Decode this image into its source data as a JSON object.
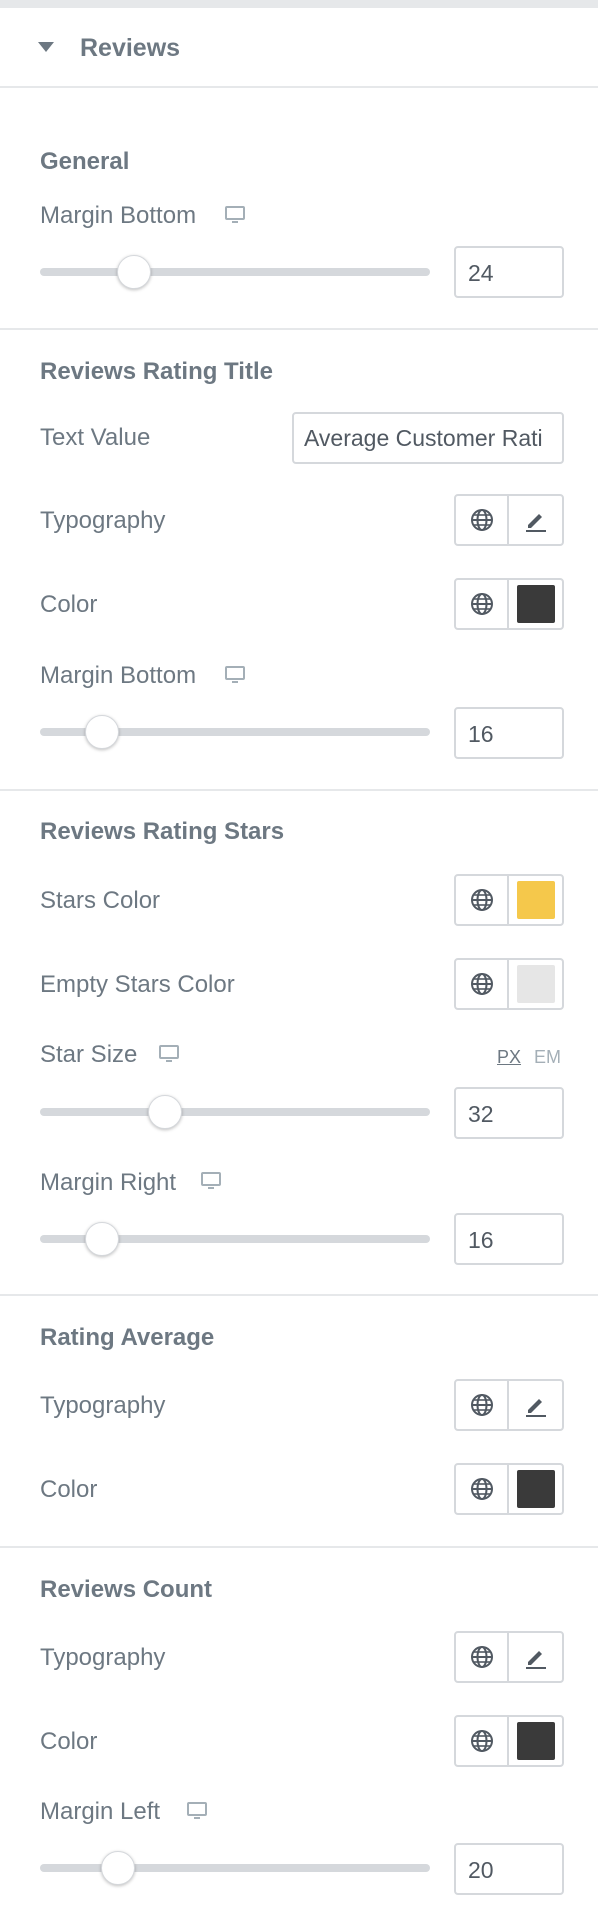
{
  "panel": {
    "title": "Reviews",
    "colors": {
      "dark_swatch": "#3a3a3a",
      "star_color": "#f5c84b",
      "empty_star_color": "#e6e6e6"
    },
    "icons": [
      "caret-down-icon",
      "monitor-icon",
      "globe-icon",
      "pencil-icon"
    ]
  },
  "general": {
    "heading": "General",
    "margin_bottom": {
      "label": "Margin Bottom",
      "value": "24",
      "level": 0.24
    }
  },
  "rating_title": {
    "heading": "Reviews Rating Title",
    "text_value": {
      "label": "Text Value",
      "value": "Average Customer Rati"
    },
    "typography_label": "Typography",
    "color_label": "Color",
    "margin_bottom": {
      "label": "Margin Bottom",
      "value": "16",
      "level": 0.16
    }
  },
  "rating_stars": {
    "heading": "Reviews Rating Stars",
    "stars_color_label": "Stars Color",
    "empty_stars_color_label": "Empty Stars Color",
    "star_size": {
      "label": "Star Size",
      "value": "32",
      "level": 0.32,
      "units": [
        "PX",
        "EM"
      ],
      "active_unit": "PX"
    },
    "margin_right": {
      "label": "Margin Right",
      "value": "16",
      "level": 0.16
    }
  },
  "rating_average": {
    "heading": "Rating Average",
    "typography_label": "Typography",
    "color_label": "Color"
  },
  "reviews_count": {
    "heading": "Reviews Count",
    "typography_label": "Typography",
    "color_label": "Color",
    "margin_left": {
      "label": "Margin Left",
      "value": "20",
      "level": 0.2
    }
  }
}
